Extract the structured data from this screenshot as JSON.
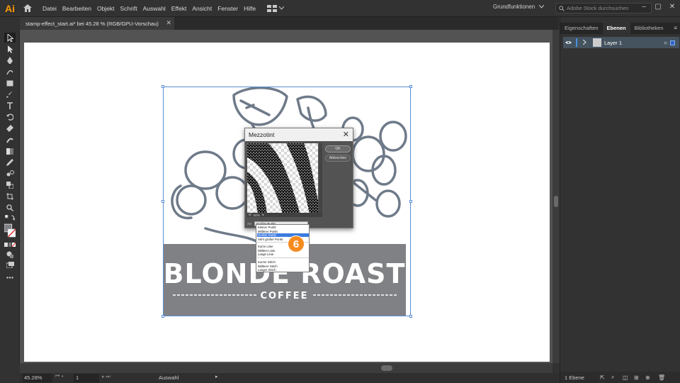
{
  "app": {
    "logo": "Ai",
    "accent": "#ff9a00"
  },
  "menu": [
    "Datei",
    "Bearbeiten",
    "Objekt",
    "Schrift",
    "Auswahl",
    "Effekt",
    "Ansicht",
    "Fenster",
    "Hilfe"
  ],
  "workspace": {
    "label": "Grundfunktionen"
  },
  "search": {
    "placeholder": "Adobe Stock durchsuchen"
  },
  "window_controls": [
    "–",
    "▢",
    "✕"
  ],
  "document_tab": {
    "title": "stamp-effect_start.ai* bei 45.28 % (RGB/GPU-Vorschau)",
    "close": "✕"
  },
  "artwork": {
    "title": "BLONDE ROAST",
    "subtitle": "COFFEE",
    "fill_color": "#808184",
    "outline_color": "#6e7a89"
  },
  "dialog": {
    "title": "Mezzotint",
    "ok_label": "OK",
    "cancel_label": "Abbrechen",
    "zoom": "50%",
    "type_label": "Art",
    "type_value": "Großer Punkt",
    "options": [
      "Kleiner Punkt",
      "Mittlerer Punkt",
      "Großer Punkt",
      "Sehr großer Punkt",
      "Kurze Linie",
      "Mittlere Linie",
      "Lange Linie",
      "Kurzer Strich",
      "Mittlerer Strich",
      "Langer Strich"
    ],
    "selected_option": "Großer Punkt"
  },
  "step_badge": "6",
  "status": {
    "zoom": "45.28%",
    "artboard_num": "1",
    "tool": "Auswahl"
  },
  "panel": {
    "tabs": [
      "Eigenschaften",
      "Ebenen",
      "Bibliotheken"
    ],
    "active_tab": "Ebenen",
    "layer": {
      "name": "Layer 1"
    },
    "layer_count": "1 Ebene"
  }
}
